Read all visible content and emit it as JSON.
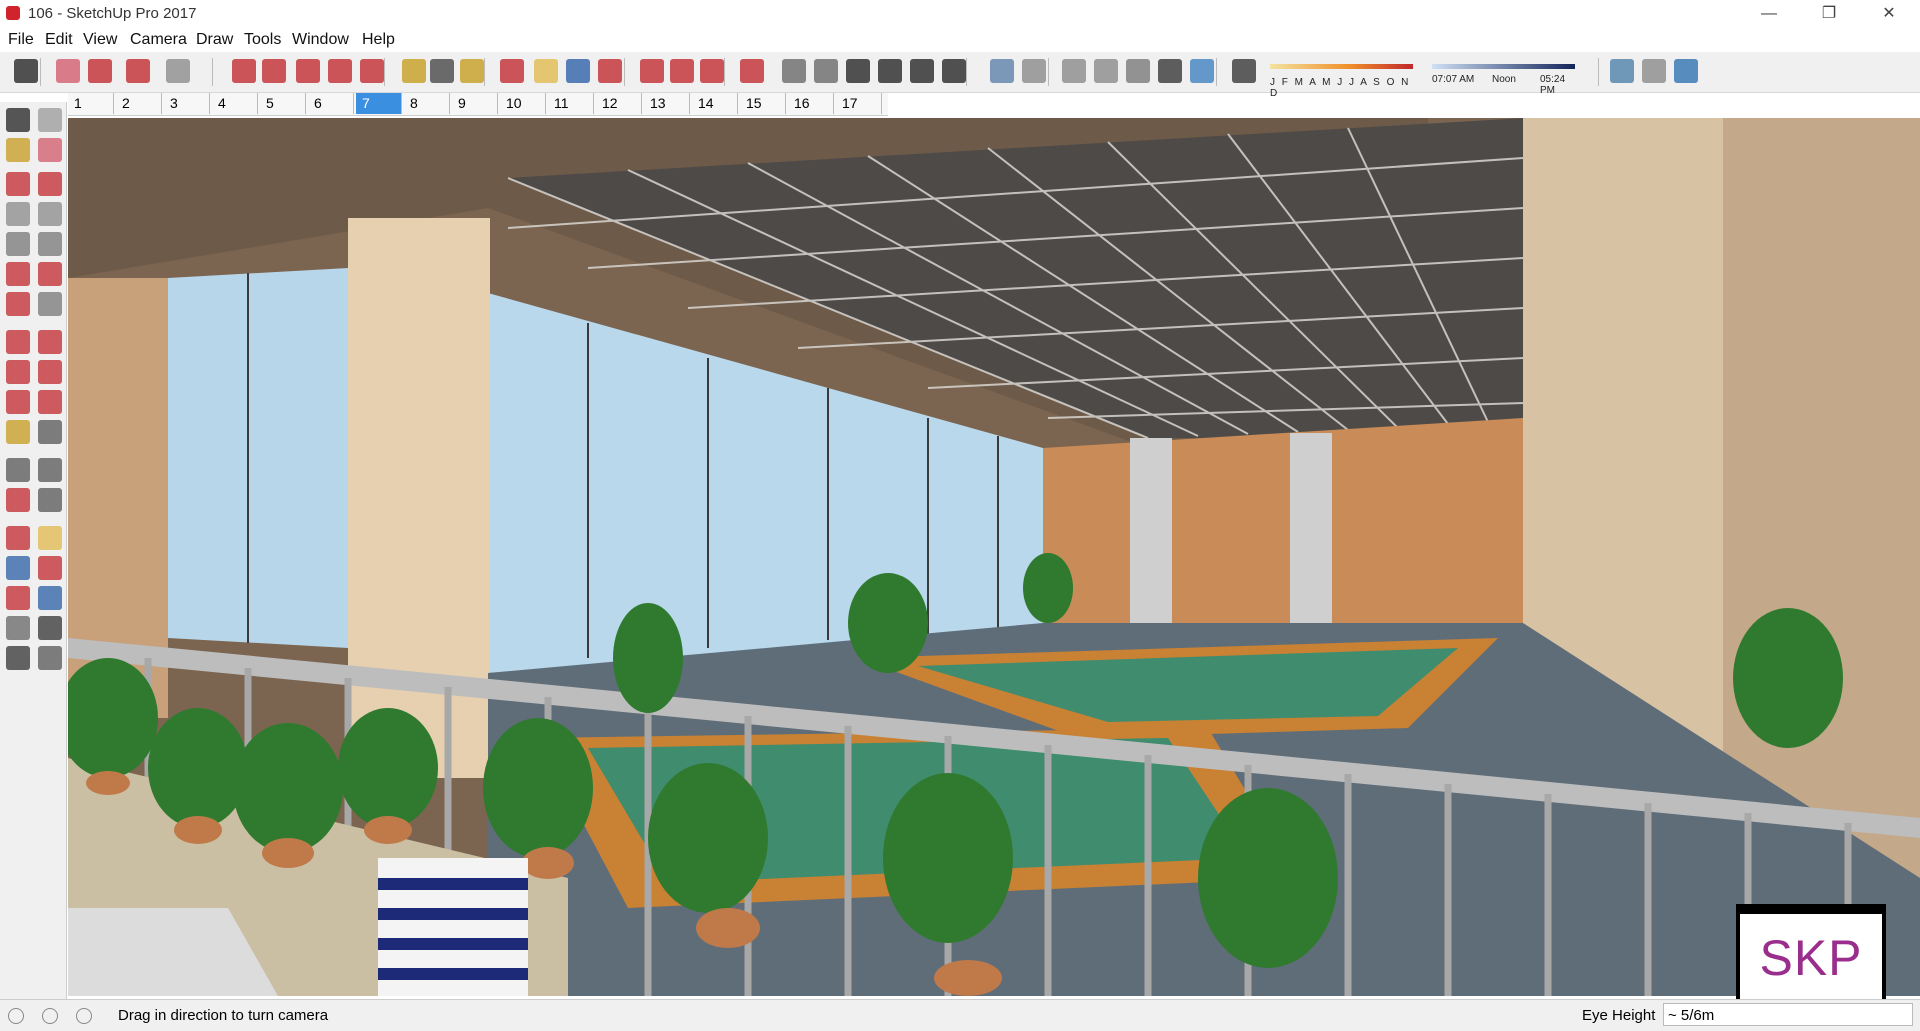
{
  "window": {
    "title": "106 - SketchUp Pro 2017",
    "minimize": "—",
    "maximize": "❐",
    "close": "✕"
  },
  "menu": [
    "File",
    "Edit",
    "View",
    "Camera",
    "Draw",
    "Tools",
    "Window",
    "Help"
  ],
  "toolbar": {
    "tools": [
      {
        "name": "select-icon",
        "color": "#222222"
      },
      {
        "name": "eraser-icon",
        "color": "#d25a6a"
      },
      {
        "name": "pencil-line-icon",
        "color": "#c0282d"
      },
      {
        "name": "arc-icon",
        "color": "#c0282d"
      },
      {
        "name": "rectangle-icon",
        "color": "#8a8a8a"
      },
      {
        "name": "push-pull-icon",
        "color": "#c0282d"
      },
      {
        "name": "follow-me-icon",
        "color": "#c0282d"
      },
      {
        "name": "move-icon",
        "color": "#c0282d"
      },
      {
        "name": "rotate-icon",
        "color": "#c0282d"
      },
      {
        "name": "scale-icon",
        "color": "#c0282d"
      },
      {
        "name": "tape-measure-icon",
        "color": "#c59b1d"
      },
      {
        "name": "text-icon",
        "color": "#444444"
      },
      {
        "name": "paint-bucket-icon",
        "color": "#c59b1d"
      },
      {
        "name": "orbit-icon",
        "color": "#c0282d"
      },
      {
        "name": "pan-icon",
        "color": "#e0b84b"
      },
      {
        "name": "zoom-icon",
        "color": "#2b5fa6"
      },
      {
        "name": "zoom-extents-icon",
        "color": "#c0282d"
      },
      {
        "name": "warehouse-icon",
        "color": "#c0282d"
      },
      {
        "name": "extension-warehouse-icon",
        "color": "#c0282d"
      },
      {
        "name": "share-model-icon",
        "color": "#c0282d"
      },
      {
        "name": "ruby-icon",
        "color": "#c0282d"
      },
      {
        "name": "iso-view-icon",
        "color": "#666666"
      },
      {
        "name": "top-view-icon",
        "color": "#666666"
      },
      {
        "name": "front-view-icon",
        "color": "#222222"
      },
      {
        "name": "right-view-icon",
        "color": "#222222"
      },
      {
        "name": "back-view-icon",
        "color": "#222222"
      },
      {
        "name": "left-view-icon",
        "color": "#222222"
      },
      {
        "name": "xray-icon",
        "color": "#5b7fa8"
      },
      {
        "name": "back-edges-icon",
        "color": "#888888"
      },
      {
        "name": "wireframe-icon",
        "color": "#888888"
      },
      {
        "name": "hidden-line-icon",
        "color": "#888888"
      },
      {
        "name": "shaded-icon",
        "color": "#777777"
      },
      {
        "name": "shaded-textures-icon",
        "color": "#333333"
      },
      {
        "name": "monochrome-icon",
        "color": "#3c7fbf"
      },
      {
        "name": "shadows-toggle-icon",
        "color": "#333333"
      },
      {
        "name": "add-location-icon",
        "color": "#4a7fa8"
      },
      {
        "name": "toggle-terrain-icon",
        "color": "#888888"
      },
      {
        "name": "photo-textures-icon",
        "color": "#2b6fb0"
      }
    ],
    "months": "J F M A M J J A S O N D",
    "time_start": "07:07 AM",
    "time_noon": "Noon",
    "time_end": "05:24 PM"
  },
  "scenes": [
    "1",
    "2",
    "3",
    "4",
    "5",
    "6",
    "7",
    "8",
    "9",
    "10",
    "11",
    "12",
    "13",
    "14",
    "15",
    "16",
    "17"
  ],
  "active_scene": "7",
  "palette": [
    "select-icon",
    "component-icon",
    "paint-bucket-icon",
    "eraser-icon",
    "line-icon",
    "freehand-icon",
    "rectangle-icon",
    "rotated-rectangle-icon",
    "circle-icon",
    "polygon-icon",
    "arc-icon",
    "two-point-arc-icon",
    "three-point-arc-icon",
    "pie-icon",
    "move-icon",
    "push-pull-icon",
    "rotate-icon",
    "follow-me-icon",
    "scale-icon",
    "offset-icon",
    "tape-measure-icon",
    "dimension-icon",
    "protractor-icon",
    "text-icon",
    "axes-icon",
    "3d-text-icon",
    "orbit-icon",
    "pan-icon",
    "zoom-icon",
    "zoom-window-icon",
    "zoom-extents-icon",
    "previous-view-icon",
    "position-camera-icon",
    "look-around-icon",
    "walk-icon",
    "section-plane-icon"
  ],
  "status": {
    "message": "Drag in direction to turn camera",
    "vcb_label": "Eye Height",
    "vcb_value": "~ 5/6m"
  },
  "watermark": "SKP"
}
